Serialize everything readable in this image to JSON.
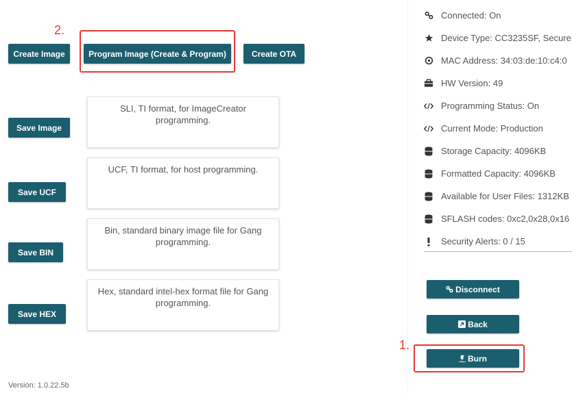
{
  "left_panel": {
    "create_image_label": "Create Image",
    "program_image_label": "Program Image (Create & Program)",
    "create_ota_label": "Create  OTA",
    "save_image_label": "Save Image",
    "save_image_desc": "SLI, TI format, for ImageCreator programming.",
    "save_ucf_label": "Save UCF",
    "save_ucf_desc": "UCF, TI format, for host programming.",
    "save_bin_label": "Save BIN",
    "save_bin_desc": "Bin, standard binary image file for Gang programming.",
    "save_hex_label": "Save HEX",
    "save_hex_desc": "Hex, standard intel-hex format file for Gang programming."
  },
  "annotations": {
    "step_2": "2.",
    "step_1": "1.",
    "highlight_color": "#e53935"
  },
  "device_info": [
    {
      "icon": "link-icon",
      "text": "Connected: On"
    },
    {
      "icon": "star-icon",
      "text": "Device Type: CC3235SF, Secure"
    },
    {
      "icon": "target-icon",
      "text": "MAC Address: 34:03:de:10:c4:0"
    },
    {
      "icon": "briefcase-icon",
      "text": "HW Version: 49"
    },
    {
      "icon": "code-icon",
      "text": "Programming Status: On"
    },
    {
      "icon": "code-icon",
      "text": "Current Mode: Production"
    },
    {
      "icon": "database-icon",
      "text": "Storage Capacity: 4096KB"
    },
    {
      "icon": "database-icon",
      "text": "Formatted Capacity: 4096KB"
    },
    {
      "icon": "database-icon",
      "text": "Available for User Files: 1312KB"
    },
    {
      "icon": "database-icon",
      "text": "SFLASH codes: 0xc2,0x28,0x16"
    },
    {
      "icon": "exclamation-icon",
      "text": "Security Alerts: 0 / 15"
    }
  ],
  "actions": {
    "disconnect_label": "Disconnect",
    "back_label": "Back",
    "burn_label": "Burn"
  },
  "footer": {
    "version": "Version: 1.0.22.5b"
  },
  "colors": {
    "button": "#1b5e6e",
    "accent_red": "#e53935"
  }
}
